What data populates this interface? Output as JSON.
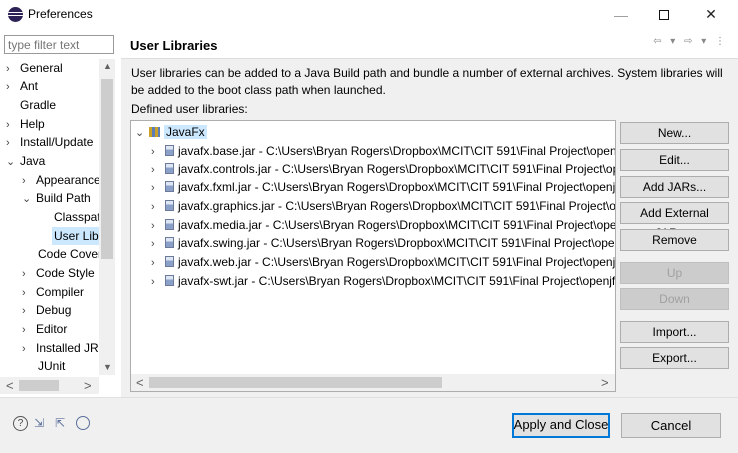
{
  "window": {
    "title": "Preferences",
    "minimize": "—",
    "close": "✕"
  },
  "sidebar": {
    "filter_placeholder": "type filter text",
    "items": [
      {
        "label": "General",
        "arrow": "›"
      },
      {
        "label": "Ant",
        "arrow": "›"
      },
      {
        "label": "Gradle",
        "arrow": ""
      },
      {
        "label": "Help",
        "arrow": "›"
      },
      {
        "label": "Install/Update",
        "arrow": "›"
      },
      {
        "label": "Java",
        "arrow": "⌄"
      },
      {
        "label": "Appearance",
        "arrow": "›"
      },
      {
        "label": "Build Path",
        "arrow": "⌄"
      },
      {
        "label": "Classpath",
        "arrow": ""
      },
      {
        "label": "User Libraries",
        "arrow": ""
      },
      {
        "label": "Code Coverage",
        "arrow": ""
      },
      {
        "label": "Code Style",
        "arrow": "›"
      },
      {
        "label": "Compiler",
        "arrow": "›"
      },
      {
        "label": "Debug",
        "arrow": "›"
      },
      {
        "label": "Editor",
        "arrow": "›"
      },
      {
        "label": "Installed JREs",
        "arrow": "›"
      },
      {
        "label": "JUnit",
        "arrow": ""
      }
    ],
    "selected": "User Libraries"
  },
  "page": {
    "title": "User Libraries",
    "nav_icons": "⇦ ▾ ⇨ ▾ ⋮",
    "description": "User libraries can be added to a Java Build path and bundle a number of external archives. System libraries will be added to the boot class path when launched.",
    "defined_label": "Defined user libraries:",
    "library": {
      "name": "JavaFx",
      "arrow": "⌄"
    },
    "jars": [
      "javafx.base.jar - C:\\Users\\Bryan Rogers\\Dropbox\\MCIT\\CIT 591\\Final Project\\openjf",
      "javafx.controls.jar - C:\\Users\\Bryan Rogers\\Dropbox\\MCIT\\CIT 591\\Final Project\\op",
      "javafx.fxml.jar - C:\\Users\\Bryan Rogers\\Dropbox\\MCIT\\CIT 591\\Final Project\\openjf:",
      "javafx.graphics.jar - C:\\Users\\Bryan Rogers\\Dropbox\\MCIT\\CIT 591\\Final Project\\op",
      "javafx.media.jar - C:\\Users\\Bryan Rogers\\Dropbox\\MCIT\\CIT 591\\Final Project\\oper",
      "javafx.swing.jar - C:\\Users\\Bryan Rogers\\Dropbox\\MCIT\\CIT 591\\Final Project\\open",
      "javafx.web.jar - C:\\Users\\Bryan Rogers\\Dropbox\\MCIT\\CIT 591\\Final Project\\openjf:",
      "javafx-swt.jar - C:\\Users\\Bryan Rogers\\Dropbox\\MCIT\\CIT 591\\Final Project\\openjfx"
    ],
    "jar_arrow": "›"
  },
  "buttons": {
    "new": "New...",
    "edit": "Edit...",
    "add_jars": "Add JARs...",
    "add_external_jars": "Add External JARs...",
    "remove": "Remove",
    "up": "Up",
    "down": "Down",
    "import": "Import...",
    "export": "Export..."
  },
  "footer": {
    "help": "?",
    "apply_close": "Apply and Close",
    "cancel": "Cancel"
  },
  "scroll": {
    "up": "▲",
    "down": "▼",
    "left": "<",
    "right": ">"
  },
  "icons": [
    "eclipse-icon",
    "help-icon",
    "import-prefs-icon",
    "export-prefs-icon",
    "oomph-icon",
    "jar-icon",
    "library-icon"
  ]
}
